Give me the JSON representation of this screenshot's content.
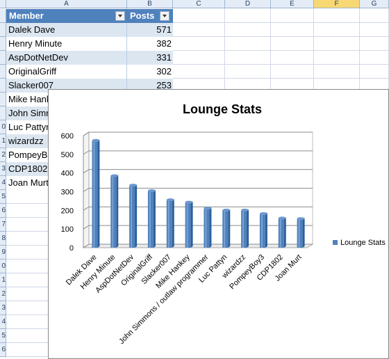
{
  "sheet": {
    "columns": [
      "A",
      "B",
      "C",
      "D",
      "E",
      "F",
      "G"
    ],
    "active_column": "F",
    "row_numbers": [
      "",
      "",
      "",
      "",
      "",
      "",
      "",
      "",
      "0",
      "1",
      "2",
      "3",
      "4",
      "5",
      "6",
      "7",
      "8",
      "9",
      "0",
      "1",
      "2",
      "3",
      "4",
      "5",
      "6"
    ],
    "table": {
      "header": {
        "member": "Member",
        "posts": "Posts"
      },
      "rows": [
        {
          "member": "Dalek Dave",
          "posts": "571"
        },
        {
          "member": "Henry Minute",
          "posts": "382"
        },
        {
          "member": "AspDotNetDev",
          "posts": "331"
        },
        {
          "member": "OriginalGriff",
          "posts": "302"
        },
        {
          "member": "Slacker007",
          "posts": "253"
        },
        {
          "member": "Mike Hankey",
          "posts": ""
        },
        {
          "member": "John Simmons / outlaw programmer",
          "posts": ""
        },
        {
          "member": "Luc Pattyn",
          "posts": ""
        },
        {
          "member": "wizardzz",
          "posts": ""
        },
        {
          "member": "PompeyBoy3",
          "posts": ""
        },
        {
          "member": "CDP1802",
          "posts": ""
        },
        {
          "member": "Joan Murt",
          "posts": ""
        }
      ]
    }
  },
  "chart_data": {
    "type": "bar",
    "title": "Lounge Stats",
    "categories": [
      "Dalek Dave",
      "Henry Minute",
      "AspDotNetDev",
      "OriginalGriff",
      "Slacker007",
      "Mike Hankey",
      "John Simmons / outlaw programmer",
      "Luc Pattyn",
      "wizardzz",
      "PompeyBoy3",
      "CDP1802",
      "Joan Murt"
    ],
    "series": [
      {
        "name": "Lounge Stats",
        "values": [
          571,
          382,
          331,
          302,
          253,
          240,
          208,
          198,
          198,
          179,
          155,
          152
        ],
        "color": "#4f81bd"
      }
    ],
    "ylim": [
      0,
      600
    ],
    "yticks": [
      "0",
      "100",
      "200",
      "300",
      "400",
      "500",
      "600"
    ],
    "grid": true,
    "legend_position": "right",
    "xlabel": "",
    "ylabel": ""
  }
}
